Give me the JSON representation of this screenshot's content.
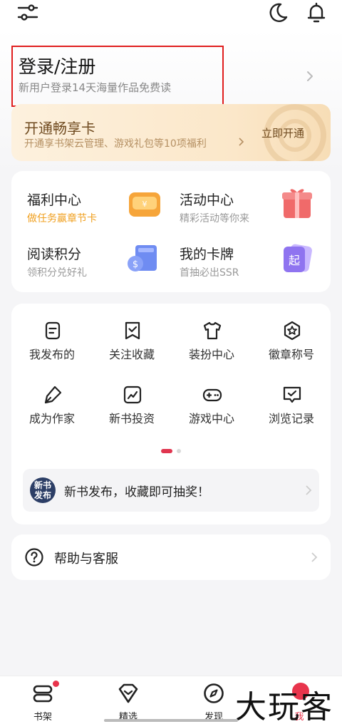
{
  "topbar": {
    "settings_icon": "sliders-icon",
    "theme_icon": "moon-icon",
    "notification_icon": "bell-icon"
  },
  "login": {
    "title": "登录/注册",
    "subtitle": "新用户登录14天海量作品免费读",
    "highlight_color": "#e01e1e"
  },
  "vip": {
    "title": "开通畅享卡",
    "subtitle": "开通享书架云管理、游戏礼包等10项福利",
    "cta": "立即开通"
  },
  "features": [
    {
      "title": "福利中心",
      "subtitle": "做任务赢章节卡",
      "icon": "coin-wallet-icon"
    },
    {
      "title": "活动中心",
      "subtitle": "精彩活动等你来",
      "icon": "gift-box-icon"
    },
    {
      "title": "阅读积分",
      "subtitle": "领积分兑好礼",
      "icon": "book-points-icon"
    },
    {
      "title": "我的卡牌",
      "subtitle": "首抽必出SSR",
      "icon": "cards-icon"
    }
  ],
  "grid": [
    {
      "label": "我发布的",
      "icon": "document-icon"
    },
    {
      "label": "关注收藏",
      "icon": "bookmark-check-icon"
    },
    {
      "label": "装扮中心",
      "icon": "tshirt-icon"
    },
    {
      "label": "徽章称号",
      "icon": "badge-star-icon"
    },
    {
      "label": "成为作家",
      "icon": "pen-icon"
    },
    {
      "label": "新书投资",
      "icon": "chart-up-icon"
    },
    {
      "label": "游戏中心",
      "icon": "gamepad-icon"
    },
    {
      "label": "浏览记录",
      "icon": "history-icon"
    }
  ],
  "pager": {
    "page": 1,
    "pages": 2
  },
  "notice": {
    "badge": "新书发布",
    "badge_line1": "新书",
    "badge_line2": "发布",
    "text": "新书发布，收藏即可抽奖！"
  },
  "help": {
    "label": "帮助与客服",
    "icon": "question-circle-icon"
  },
  "tabs": [
    {
      "label": "书架",
      "icon": "bookshelf-icon"
    },
    {
      "label": "精选",
      "icon": "diamond-icon"
    },
    {
      "label": "发现",
      "icon": "compass-icon"
    },
    {
      "label": "我",
      "icon": "profile-icon"
    }
  ],
  "watermark": "大玩客",
  "colors": {
    "accent": "#e0354f",
    "vip_text": "#6f4a1f",
    "orange_sub": "#f0a020"
  }
}
